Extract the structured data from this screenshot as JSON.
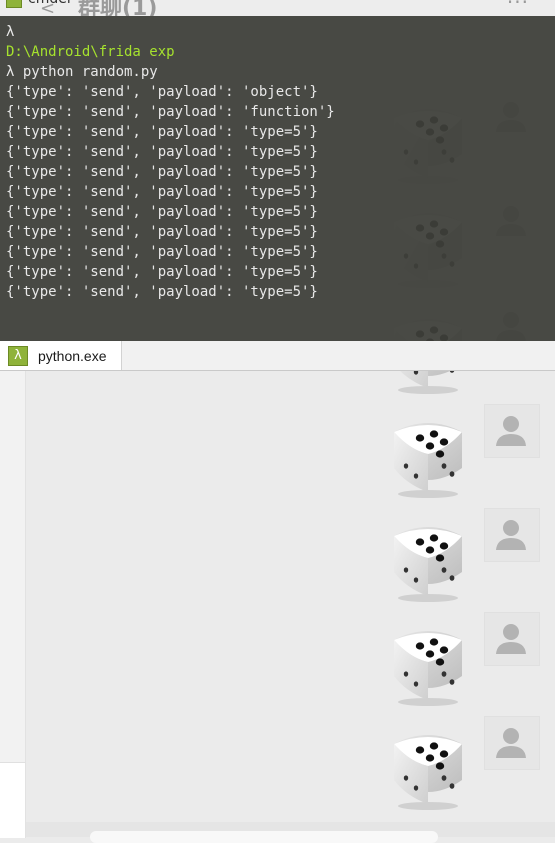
{
  "app": {
    "small_window_title": "cmder",
    "chat_title": "群聊(1)",
    "back_glyph": "<",
    "more_glyph": "···"
  },
  "terminal": {
    "prompt_symbol": "λ",
    "path": "D:\\Android\\frida exp",
    "command": "λ python random.py",
    "output_lines": [
      "{'type': 'send', 'payload': 'object'}",
      "{'type': 'send', 'payload': 'function'}",
      "{'type': 'send', 'payload': 'type=5'}",
      "{'type': 'send', 'payload': 'type=5'}",
      "{'type': 'send', 'payload': 'type=5'}",
      "{'type': 'send', 'payload': 'type=5'}",
      "{'type': 'send', 'payload': 'type=5'}",
      "{'type': 'send', 'payload': 'type=5'}",
      "{'type': 'send', 'payload': 'type=5'}",
      "{'type': 'send', 'payload': 'type=5'}",
      "{'type': 'send', 'payload': 'type=5'}"
    ],
    "tab": {
      "icon_glyph": "λ",
      "label": "python.exe"
    }
  },
  "chat": {
    "dice_messages": [
      {
        "face": 5,
        "icon": "dice-five-icon",
        "sender_icon": "default-avatar-icon"
      },
      {
        "face": 5,
        "icon": "dice-five-icon",
        "sender_icon": "default-avatar-icon"
      },
      {
        "face": 5,
        "icon": "dice-five-icon",
        "sender_icon": "default-avatar-icon"
      },
      {
        "face": 5,
        "icon": "dice-five-icon",
        "sender_icon": "default-avatar-icon"
      },
      {
        "face": 5,
        "icon": "dice-five-icon",
        "sender_icon": "default-avatar-icon"
      },
      {
        "face": 5,
        "icon": "dice-five-icon",
        "sender_icon": "default-avatar-icon"
      },
      {
        "face": 5,
        "icon": "dice-five-icon",
        "sender_icon": "default-avatar-icon"
      }
    ]
  },
  "colors": {
    "terminal_bg": "#3e3f39",
    "terminal_path": "#a6e22e",
    "chat_bg": "#ebebeb",
    "cmder_accent": "#8fb33a"
  }
}
